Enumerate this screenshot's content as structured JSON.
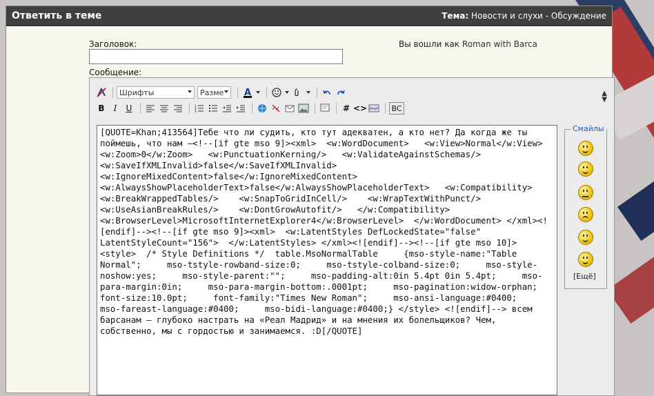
{
  "header": {
    "left_title": "Ответить в теме",
    "theme_label": "Тема:",
    "theme_value": "Новости и слухи - Обсуждение"
  },
  "form": {
    "subject_label": "Заголовок:",
    "message_label": "Сообщение:",
    "logged_prefix": "Вы вошли как",
    "logged_user": "Roman with Barca",
    "subject_value": ""
  },
  "toolbar": {
    "font_dropdown": "Шрифты",
    "size_dropdown": "Разме"
  },
  "smilies": {
    "legend": "Смайлы",
    "more": "[Ещё]",
    "icons": [
      "smile-icon",
      "tongue-smile-icon",
      "confused-smile-icon",
      "cry-smile-icon",
      "angel-smile-icon",
      "grin-smile-icon"
    ]
  },
  "message_text": "[QUOTE=Khan;413564]Тебе что ли судить, кто тут адекватен, а кто нет? Да когда же ты поймешь, что нам —<!--[if gte mso 9]><xml>  <w:WordDocument>   <w:View>Normal</w:View>   <w:Zoom>0</w:Zoom>   <w:PunctuationKerning/>   <w:ValidateAgainstSchemas/>   <w:SaveIfXMLInvalid>false</w:SaveIfXMLInvalid>   <w:IgnoreMixedContent>false</w:IgnoreMixedContent>   <w:AlwaysShowPlaceholderText>false</w:AlwaysShowPlaceholderText>   <w:Compatibility>    <w:BreakWrappedTables/>    <w:SnapToGridInCell/>    <w:WrapTextWithPunct/>    <w:UseAsianBreakRules/>    <w:DontGrowAutofit/>   </w:Compatibility>   <w:BrowserLevel>MicrosoftInternetExplorer4</w:BrowserLevel>  </w:WordDocument> </xml><![endif]--><!--[if gte mso 9]><xml>  <w:LatentStyles DefLockedState=\"false\" LatentStyleCount=\"156\">  </w:LatentStyles> </xml><![endif]--><!--[if gte mso 10]> <style>  /* Style Definitions */  table.MsoNormalTable     {mso-style-name:\"Table Normal\";     mso-tstyle-rowband-size:0;     mso-tstyle-colband-size:0;     mso-style-noshow:yes;     mso-style-parent:\"\";     mso-padding-alt:0in 5.4pt 0in 5.4pt;     mso-para-margin:0in;     mso-para-margin-bottom:.0001pt;     mso-pagination:widow-orphan;     font-size:10.0pt;     font-family:\"Times New Roman\";     mso-ansi-language:#0400;     mso-fareast-language:#0400;     mso-bidi-language:#0400;} </style> <![endif]--> всем барсанам — глубоко настрать на «Реал Мадрид» и на мнения их болельщиков? Чем, собственно, мы с гордостью и занимаемся. :D[/QUOTE]"
}
